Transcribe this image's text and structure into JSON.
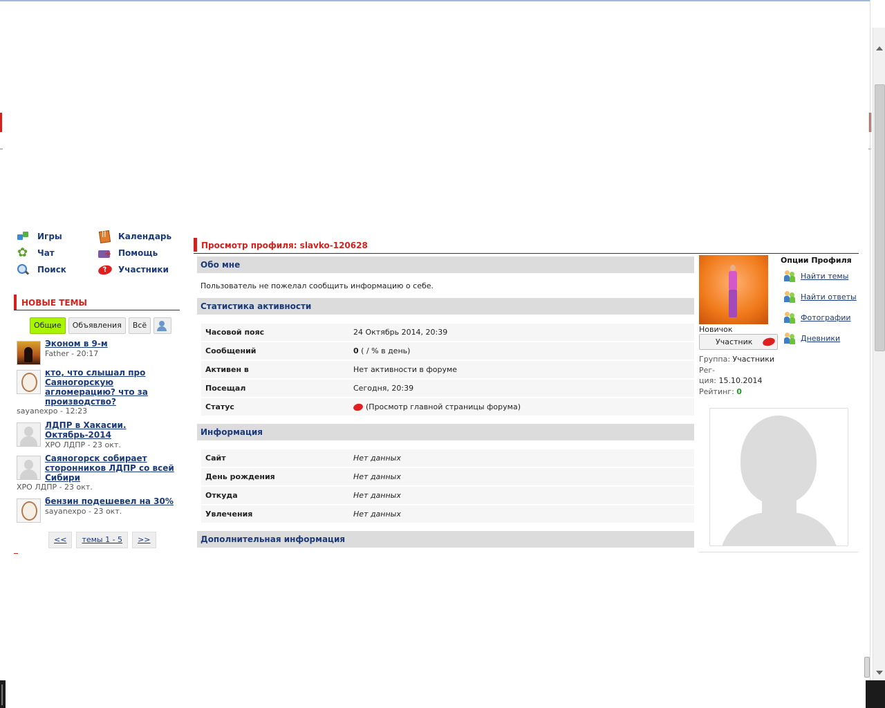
{
  "quick_menu": {
    "games": "Игры",
    "calendar": "Календарь",
    "chat": "Чат",
    "help": "Помощь",
    "search": "Поиск",
    "members": "Участники"
  },
  "new_topics": {
    "title": "НОВЫЕ ТЕМЫ",
    "filters": [
      "Общие",
      "Объявления",
      "Всё"
    ],
    "items": [
      {
        "title": "Эконом в 9-м",
        "meta": "Father - 20:17"
      },
      {
        "title": "кто, что слышал про Саяногорскую агломерацию? что за производство?",
        "meta": "sayanexpo - 12:23"
      },
      {
        "title": "ЛДПР в Хакасии. Октябрь-2014",
        "meta": "ХРО ЛДПР - 23 окт."
      },
      {
        "title": "Саяногорск собирает сторонников ЛДПР со всей Сибири",
        "meta": "ХРО ЛДПР - 23 окт."
      },
      {
        "title": "бензин подешевел на 30%",
        "meta": "sayanexpo - 23 окт."
      }
    ],
    "pager": {
      "prev": "<<",
      "current": "темы 1 - 5",
      "next": ">>"
    }
  },
  "profile": {
    "title": "Просмотр профиля: slavko-120628",
    "about_header": "Обо мне",
    "about_text": "Пользователь не пожелал сообщить информацию о себе.",
    "stats_header": "Статистика активности",
    "stats": [
      {
        "key": "Часовой пояс",
        "value": "24 Октябрь 2014, 20:39"
      },
      {
        "key": "Сообщений",
        "value_bold": "0",
        "value": " ( / % в день)"
      },
      {
        "key": "Активен в",
        "value": "Нет активности в форуме"
      },
      {
        "key": "Посещал",
        "value": "Сегодня, 20:39"
      },
      {
        "key": "Статус",
        "value": "(Просмотр главной страницы форума)"
      }
    ],
    "info_header": "Информация",
    "info": [
      {
        "key": "Сайт",
        "value": "Нет данных"
      },
      {
        "key": "День рождения",
        "value": "Нет данных"
      },
      {
        "key": "Откуда",
        "value": "Нет данных"
      },
      {
        "key": "Увлечения",
        "value": "Нет данных"
      }
    ],
    "extra_header": "Дополнительная информация"
  },
  "sidebar_right": {
    "rank": "Новичок",
    "group_button": "Участник",
    "group_label": "Группа:",
    "group_value": "Участники",
    "reg_label_1": "Рег-",
    "reg_label_2": "ция:",
    "reg_value": "15.10.2014",
    "rating_label": "Рейтинг:",
    "rating_value": "0",
    "options_title": "Опции Профиля",
    "options": [
      "Найти темы",
      "Найти ответы",
      "Фотографии",
      "Дневники"
    ]
  },
  "colors": {
    "accent_red": "#d4211b",
    "link_blue": "#1a3a7a",
    "active_filter": "#a9f500"
  }
}
